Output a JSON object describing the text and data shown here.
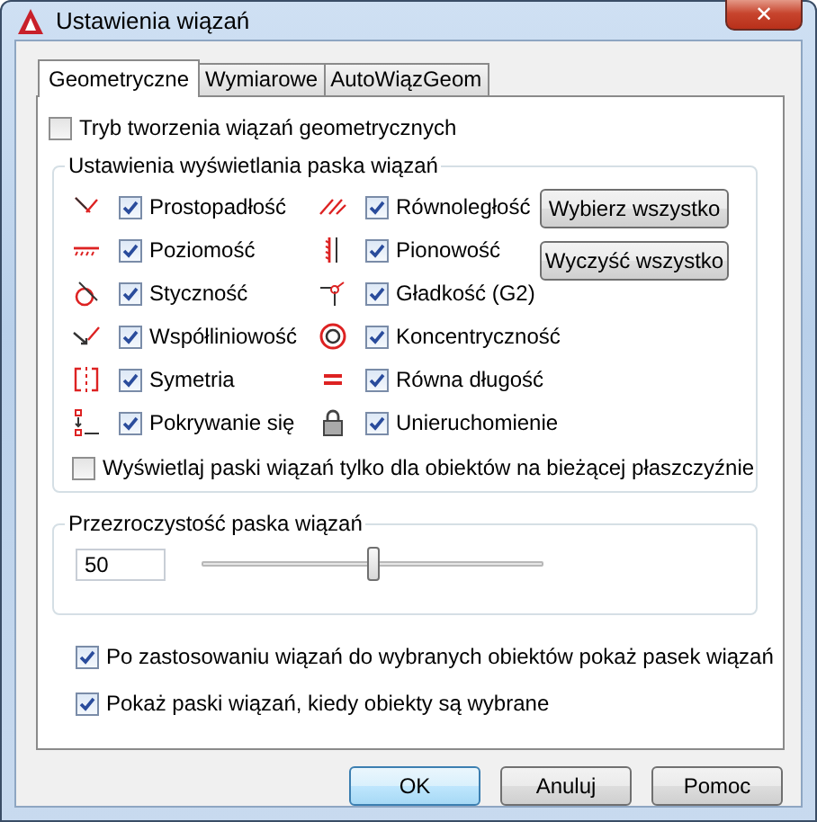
{
  "window": {
    "title": "Ustawienia wiązań",
    "close": "✕"
  },
  "tabs": [
    {
      "label": "Geometryczne",
      "selected": true
    },
    {
      "label": "Wymiarowe",
      "selected": false
    },
    {
      "label": "AutoWiązGeom",
      "selected": false
    }
  ],
  "mode_checkbox": {
    "label": "Tryb tworzenia wiązań geometrycznych",
    "checked": false
  },
  "display_group": {
    "title": "Ustawienia wyświetlania paska wiązań",
    "constraints": [
      {
        "label": "Prostopadłość",
        "checked": true
      },
      {
        "label": "Równoległość",
        "checked": true
      },
      {
        "label": "Poziomość",
        "checked": true
      },
      {
        "label": "Pionowość",
        "checked": true
      },
      {
        "label": "Styczność",
        "checked": true
      },
      {
        "label": "Gładkość (G2)",
        "checked": true
      },
      {
        "label": "Współliniowość",
        "checked": true
      },
      {
        "label": "Koncentryczność",
        "checked": true
      },
      {
        "label": "Symetria",
        "checked": true
      },
      {
        "label": "Równa długość",
        "checked": true
      },
      {
        "label": "Pokrywanie się",
        "checked": true
      },
      {
        "label": "Unieruchomienie",
        "checked": true
      }
    ],
    "buttons": [
      "Wybierz wszystko",
      "Wyczyść wszystko"
    ],
    "plane_checkbox": {
      "label": "Wyświetlaj paski wiązań tylko dla obiektów na bieżącej płaszczyźnie",
      "checked": false
    }
  },
  "transparency_group": {
    "title": "Przezroczystość paska wiązań",
    "value": "50",
    "level": 0.5
  },
  "options": [
    {
      "label": "Po zastosowaniu wiązań do wybranych obiektów pokaż pasek wiązań",
      "checked": true
    },
    {
      "label": "Pokaż paski wiązań, kiedy obiekty są wybrane",
      "checked": true
    }
  ],
  "buttons": [
    "OK",
    "Anuluj",
    "Pomoc"
  ]
}
